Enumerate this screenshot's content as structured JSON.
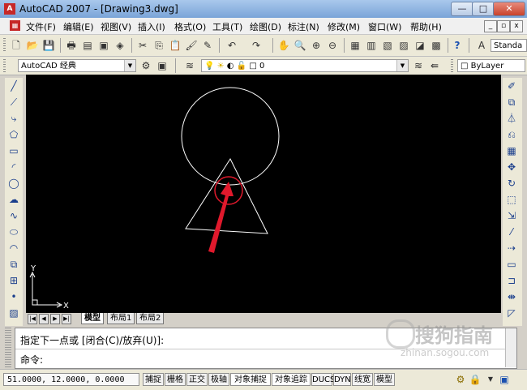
{
  "window": {
    "title": "AutoCAD 2007 - [Drawing3.dwg]",
    "app_icon_glyph": "A",
    "controls": {
      "minimize": "—",
      "maximize": "□",
      "close": "✕"
    }
  },
  "menu": {
    "items": [
      "文件(F)",
      "编辑(E)",
      "视图(V)",
      "插入(I)",
      "格式(O)",
      "工具(T)",
      "绘图(D)",
      "标注(N)",
      "修改(M)",
      "窗口(W)",
      "帮助(H)"
    ],
    "doc_controls": {
      "minimize": "_",
      "restore": "▫",
      "close": "x"
    }
  },
  "toolbar": {
    "text_style": "Standa",
    "workspace": "AutoCAD 经典",
    "layer": "0",
    "linetype_label": "ByLayer"
  },
  "drawing": {
    "shapes": [
      "circle",
      "triangle"
    ],
    "annotation_color": "#e0192c",
    "ucs": {
      "x_label": "X",
      "y_label": "Y"
    }
  },
  "layout_tabs": {
    "nav": [
      "|◀",
      "◀",
      "▶",
      "▶|"
    ],
    "tabs": [
      "模型",
      "布局1",
      "布局2"
    ]
  },
  "command": {
    "line1": "指定下一点或 [闭合(C)/放弃(U)]:",
    "line2": "命令:"
  },
  "watermark": {
    "text": "搜狗指南",
    "sub": "zhinan.sogou.com"
  },
  "status": {
    "coords": "51.0000, 12.0000, 0.0000",
    "buttons": [
      "捕捉",
      "栅格",
      "正交",
      "极轴",
      "对象捕捉",
      "对象追踪",
      "DUCS",
      "DYN",
      "线宽",
      "模型"
    ]
  }
}
